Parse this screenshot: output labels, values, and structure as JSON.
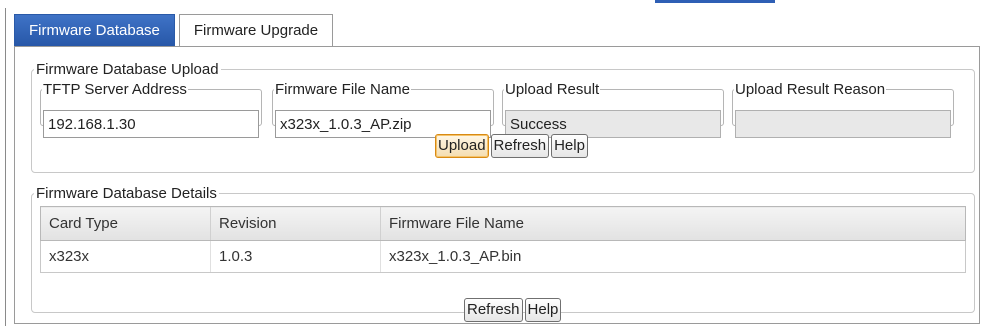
{
  "tabs": [
    {
      "label": "Firmware Database",
      "active": true
    },
    {
      "label": "Firmware Upgrade",
      "active": false
    }
  ],
  "upload_section": {
    "title": "Firmware Database Upload",
    "fields": {
      "tftp_server_address": {
        "label": "TFTP Server Address",
        "value": "192.168.1.30"
      },
      "firmware_file_name": {
        "label": "Firmware File Name",
        "value": "x323x_1.0.3_AP.zip"
      },
      "upload_result": {
        "label": "Upload Result",
        "value": "Success"
      },
      "upload_result_reason": {
        "label": "Upload Result Reason",
        "value": ""
      }
    },
    "buttons": {
      "upload": "Upload",
      "refresh": "Refresh",
      "help": "Help"
    }
  },
  "details_section": {
    "title": "Firmware Database Details",
    "columns": [
      "Card Type",
      "Revision",
      "Firmware File Name"
    ],
    "rows": [
      [
        "x323x",
        "1.0.3",
        "x323x_1.0.3_AP.bin"
      ]
    ],
    "buttons": {
      "refresh": "Refresh",
      "help": "Help"
    }
  },
  "colors": {
    "active_tab": "#2f63b8",
    "readonly_field": "#e8e8e8",
    "focused_button_border": "#d88a14"
  }
}
